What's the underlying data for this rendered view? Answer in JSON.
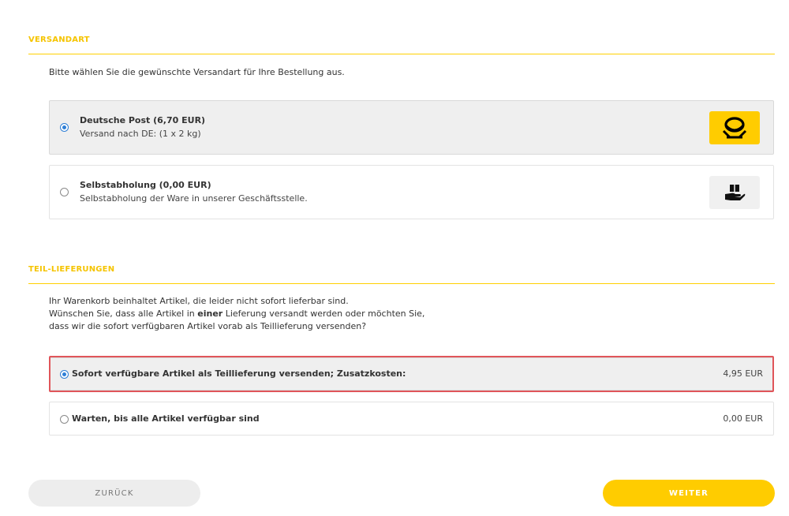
{
  "shipping": {
    "title": "VERSANDART",
    "intro": "Bitte wählen Sie die gewünschte Versandart für Ihre Bestellung aus.",
    "options": [
      {
        "title": "Deutsche Post (6,70 EUR)",
        "subtitle": "Versand nach DE: (1 x 2 kg)",
        "selected": true,
        "icon": "deutsche-post-horn-icon"
      },
      {
        "title": "Selbstabholung (0,00 EUR)",
        "subtitle": "Selbstabholung der Ware in unserer Geschäftsstelle.",
        "selected": false,
        "icon": "hand-package-icon"
      }
    ]
  },
  "partial": {
    "title": "TEIL-LIEFERUNGEN",
    "intro_line1": "Ihr Warenkorb beinhaltet Artikel, die leider nicht sofort lieferbar sind.",
    "intro_line2_pre": "Wünschen Sie, dass alle Artikel in ",
    "intro_line2_bold": "einer",
    "intro_line2_post": " Lieferung versandt werden oder möchten Sie,",
    "intro_line3": "dass wir die sofort verfügbaren Artikel vorab als Teillieferung versenden?",
    "options": [
      {
        "label": "Sofort verfügbare Artikel als Teillieferung versenden; Zusatzkosten:",
        "price": "4,95 EUR",
        "selected": true
      },
      {
        "label": "Warten, bis alle Artikel verfügbar sind",
        "price": "0,00 EUR",
        "selected": false
      }
    ]
  },
  "buttons": {
    "back": "ZURÜCK",
    "next": "WEITER"
  },
  "colors": {
    "accent": "#ffcc00",
    "radio": "#2f7fd6",
    "highlight": "#e0555a"
  }
}
